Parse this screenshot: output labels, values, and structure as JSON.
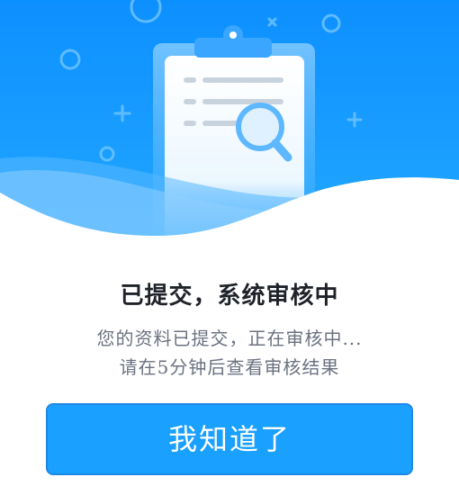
{
  "dialog": {
    "title": "已提交，系统审核中",
    "message_line1": "您的资料已提交，正在审核中...",
    "message_line2": "请在5分钟后查看审核结果",
    "confirm_label": "我知道了"
  },
  "icons": {
    "hero": "clipboard-search-illustration"
  },
  "colors": {
    "hero_blue": "#159bff",
    "button_blue": "#1aa0ff",
    "title_text": "#1f2329",
    "body_text": "#6b7280"
  }
}
